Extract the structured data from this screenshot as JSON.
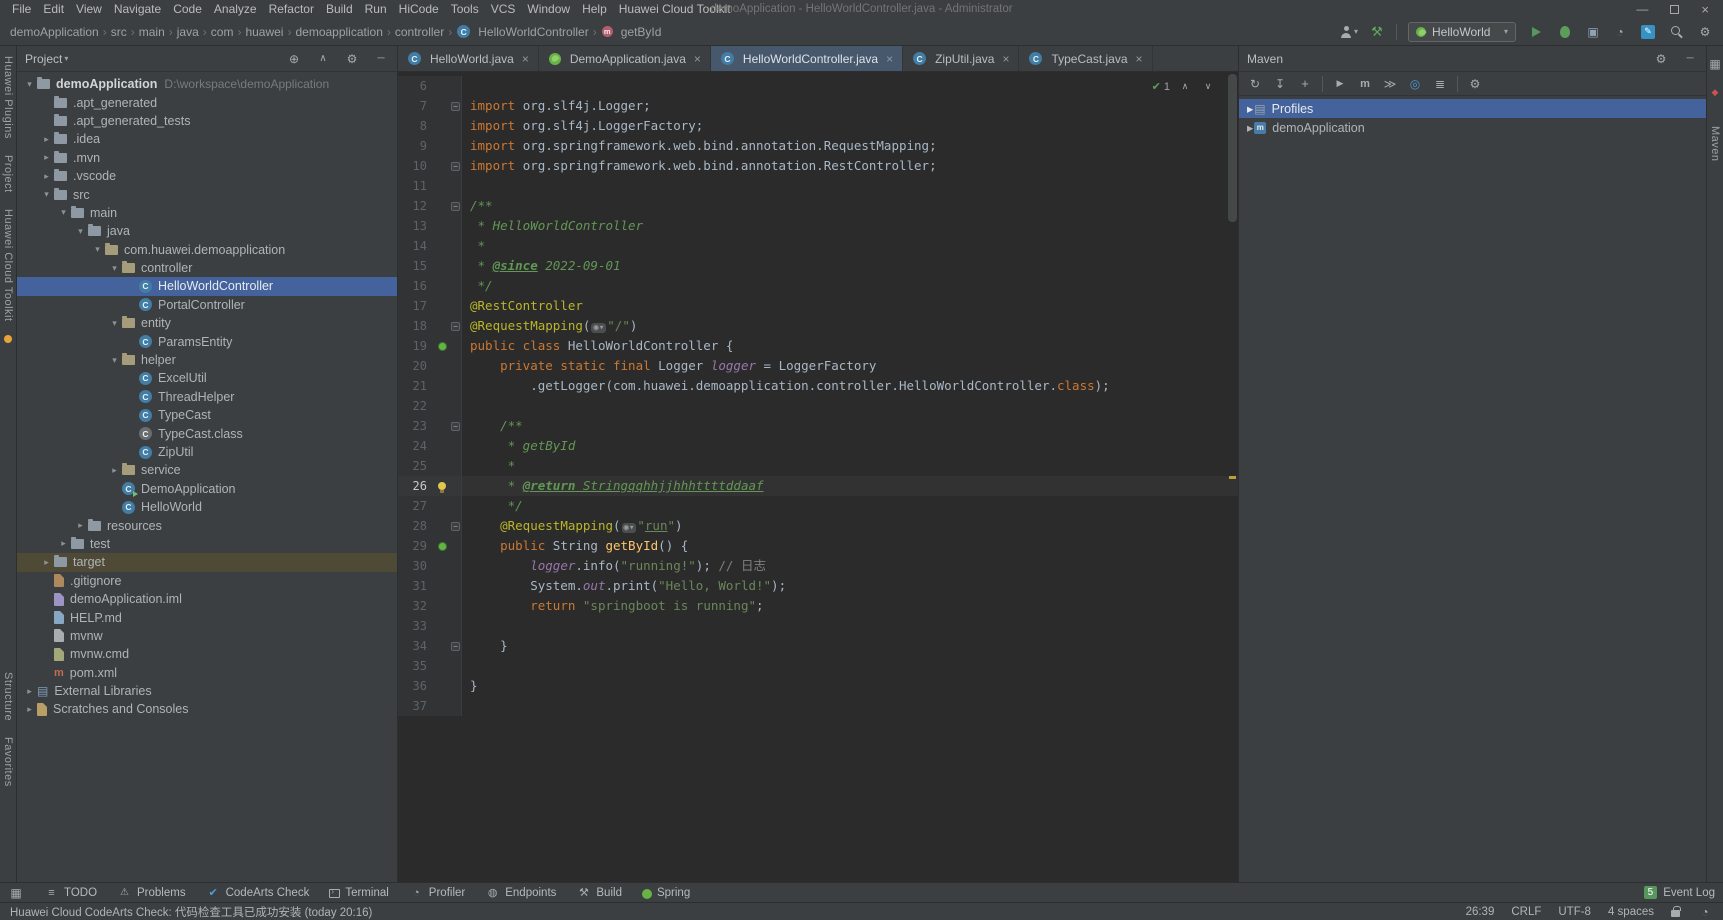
{
  "colors": {
    "panel_bg": "#3c3f41",
    "editor_bg": "#2b2b2b",
    "selection_blue": "#44639d",
    "target_highlight": "#4e4a35",
    "accent_green": "#57965c",
    "keyword_orange": "#cc7832",
    "string_green": "#6a8759",
    "annotation_yellow": "#bbb529"
  },
  "title_bar": {
    "menus": [
      "File",
      "Edit",
      "View",
      "Navigate",
      "Code",
      "Analyze",
      "Refactor",
      "Build",
      "Run",
      "HiCode",
      "Tools",
      "VCS",
      "Window",
      "Help",
      "Huawei Cloud Toolkit"
    ],
    "title": "demoApplication - HelloWorldController.java - Administrator"
  },
  "nav_bar": {
    "breadcrumbs": [
      {
        "label": "demoApplication"
      },
      {
        "label": "src"
      },
      {
        "label": "main"
      },
      {
        "label": "java"
      },
      {
        "label": "com"
      },
      {
        "label": "huawei"
      },
      {
        "label": "demoapplication"
      },
      {
        "label": "controller"
      },
      {
        "label": "HelloWorldController",
        "icon": "cls"
      },
      {
        "label": "getById",
        "icon": "mth"
      }
    ],
    "run_config": "HelloWorld"
  },
  "left_stripe": {
    "top": [
      "Huawei Plugins",
      "Project",
      "Huawei Cloud Toolkit"
    ],
    "bottom": [
      "Structure",
      "Favorites"
    ]
  },
  "right_stripe": {
    "labels": [
      "Maven"
    ]
  },
  "project": {
    "header_title": "Project",
    "tree": [
      {
        "label": "demoApplication",
        "path": "D:\\workspace\\demoApplication",
        "depth": 0,
        "arrow": "down",
        "icon": "folder",
        "root": true
      },
      {
        "label": ".apt_generated",
        "depth": 1,
        "arrow": "none",
        "icon": "folder"
      },
      {
        "label": ".apt_generated_tests",
        "depth": 1,
        "arrow": "none",
        "icon": "folder"
      },
      {
        "label": ".idea",
        "depth": 1,
        "arrow": "right",
        "icon": "folder"
      },
      {
        "label": ".mvn",
        "depth": 1,
        "arrow": "right",
        "icon": "folder"
      },
      {
        "label": ".vscode",
        "depth": 1,
        "arrow": "right",
        "icon": "folder"
      },
      {
        "label": "src",
        "depth": 1,
        "arrow": "down",
        "icon": "folder"
      },
      {
        "label": "main",
        "depth": 2,
        "arrow": "down",
        "icon": "folder"
      },
      {
        "label": "java",
        "depth": 3,
        "arrow": "down",
        "icon": "folder"
      },
      {
        "label": "com.huawei.demoapplication",
        "depth": 4,
        "arrow": "down",
        "icon": "pkg"
      },
      {
        "label": "controller",
        "depth": 5,
        "arrow": "down",
        "icon": "pkg"
      },
      {
        "label": "HelloWorldController",
        "depth": 6,
        "arrow": "none",
        "icon": "cls",
        "selected": true
      },
      {
        "label": "PortalController",
        "depth": 6,
        "arrow": "none",
        "icon": "cls"
      },
      {
        "label": "entity",
        "depth": 5,
        "arrow": "down",
        "icon": "pkg"
      },
      {
        "label": "ParamsEntity",
        "depth": 6,
        "arrow": "none",
        "icon": "cls"
      },
      {
        "label": "helper",
        "depth": 5,
        "arrow": "down",
        "icon": "pkg"
      },
      {
        "label": "ExcelUtil",
        "depth": 6,
        "arrow": "none",
        "icon": "cls"
      },
      {
        "label": "ThreadHelper",
        "depth": 6,
        "arrow": "none",
        "icon": "cls"
      },
      {
        "label": "TypeCast",
        "depth": 6,
        "arrow": "none",
        "icon": "cls"
      },
      {
        "label": "TypeCast.class",
        "depth": 6,
        "arrow": "none",
        "icon": "clsfile"
      },
      {
        "label": "ZipUtil",
        "depth": 6,
        "arrow": "none",
        "icon": "cls"
      },
      {
        "label": "service",
        "depth": 5,
        "arrow": "right",
        "icon": "pkg"
      },
      {
        "label": "DemoApplication",
        "depth": 5,
        "arrow": "none",
        "icon": "clsrun"
      },
      {
        "label": "HelloWorld",
        "depth": 5,
        "arrow": "none",
        "icon": "cls"
      },
      {
        "label": "resources",
        "depth": 3,
        "arrow": "right",
        "icon": "folder"
      },
      {
        "label": "test",
        "depth": 2,
        "arrow": "right",
        "icon": "folder"
      },
      {
        "label": "target",
        "depth": 1,
        "arrow": "right",
        "icon": "folder",
        "highlight": true
      },
      {
        "label": ".gitignore",
        "depth": 1,
        "arrow": "none",
        "icon": "git"
      },
      {
        "label": "demoApplication.iml",
        "depth": 1,
        "arrow": "none",
        "icon": "iml"
      },
      {
        "label": "HELP.md",
        "depth": 1,
        "arrow": "none",
        "icon": "md"
      },
      {
        "label": "mvnw",
        "depth": 1,
        "arrow": "none",
        "icon": "file"
      },
      {
        "label": "mvnw.cmd",
        "depth": 1,
        "arrow": "none",
        "icon": "cmd"
      },
      {
        "label": "pom.xml",
        "depth": 1,
        "arrow": "none",
        "icon": "maven"
      },
      {
        "label": "External Libraries",
        "depth": 0,
        "arrow": "right",
        "icon": "lib"
      },
      {
        "label": "Scratches and Consoles",
        "depth": 0,
        "arrow": "right",
        "icon": "scratch"
      }
    ]
  },
  "editor": {
    "tabs": [
      {
        "label": "HelloWorld.java",
        "icon": "cls"
      },
      {
        "label": "DemoApplication.java",
        "icon": "spring"
      },
      {
        "label": "HelloWorldController.java",
        "icon": "cls",
        "active": true
      },
      {
        "label": "ZipUtil.java",
        "icon": "cls"
      },
      {
        "label": "TypeCast.java",
        "icon": "cls"
      }
    ],
    "inspection_count": "1",
    "lines": [
      {
        "n": 6,
        "segs": []
      },
      {
        "n": 7,
        "fold": true,
        "segs": [
          {
            "c": "kw",
            "t": "import "
          },
          {
            "c": "p",
            "t": "org.slf4j.Logger;"
          }
        ]
      },
      {
        "n": 8,
        "segs": [
          {
            "c": "kw",
            "t": "import "
          },
          {
            "c": "p",
            "t": "org.slf4j.LoggerFactory;"
          }
        ]
      },
      {
        "n": 9,
        "segs": [
          {
            "c": "kw",
            "t": "import "
          },
          {
            "c": "p",
            "t": "org.springframework.web.bind.annotation.RequestMapping;"
          }
        ]
      },
      {
        "n": 10,
        "fold": true,
        "segs": [
          {
            "c": "kw",
            "t": "import "
          },
          {
            "c": "p",
            "t": "org.springframework.web.bind.annotation.RestController;"
          }
        ]
      },
      {
        "n": 11,
        "segs": []
      },
      {
        "n": 12,
        "fold": true,
        "segs": [
          {
            "c": "doc",
            "t": "/**"
          }
        ]
      },
      {
        "n": 13,
        "segs": [
          {
            "c": "doc",
            "t": " * HelloWorldController"
          }
        ]
      },
      {
        "n": 14,
        "segs": [
          {
            "c": "doc",
            "t": " *"
          }
        ]
      },
      {
        "n": 15,
        "segs": [
          {
            "c": "doc",
            "t": " * "
          },
          {
            "c": "dtag",
            "t": "@since"
          },
          {
            "c": "doc",
            "t": " 2022-09-01"
          }
        ]
      },
      {
        "n": 16,
        "segs": [
          {
            "c": "doc",
            "t": " */"
          }
        ]
      },
      {
        "n": 17,
        "segs": [
          {
            "c": "ann",
            "t": "@RestController"
          }
        ]
      },
      {
        "n": 18,
        "fold": true,
        "segs": [
          {
            "c": "ann",
            "t": "@RequestMapping"
          },
          {
            "c": "p",
            "t": "("
          },
          {
            "c": "inlay",
            "t": "◉▾"
          },
          {
            "c": "str",
            "t": "\"/\""
          },
          {
            "c": "p",
            "t": ")"
          }
        ]
      },
      {
        "n": 19,
        "bean": true,
        "segs": [
          {
            "c": "kw",
            "t": "public class "
          },
          {
            "c": "p",
            "t": "HelloWorldController {"
          }
        ]
      },
      {
        "n": 20,
        "segs": [
          {
            "c": "p",
            "t": "    "
          },
          {
            "c": "kw",
            "t": "private static final "
          },
          {
            "c": "p",
            "t": "Logger "
          },
          {
            "c": "fld",
            "t": "logger"
          },
          {
            "c": "p",
            "t": " = LoggerFactory"
          }
        ]
      },
      {
        "n": 21,
        "segs": [
          {
            "c": "p",
            "t": "        .getLogger(com.huawei.demoapplication.controller.HelloWorldController."
          },
          {
            "c": "kw",
            "t": "class"
          },
          {
            "c": "p",
            "t": ");"
          }
        ]
      },
      {
        "n": 22,
        "segs": []
      },
      {
        "n": 23,
        "fold": true,
        "segs": [
          {
            "c": "p",
            "t": "    "
          },
          {
            "c": "doc",
            "t": "/**"
          }
        ]
      },
      {
        "n": 24,
        "segs": [
          {
            "c": "doc",
            "t": "     * getById"
          }
        ]
      },
      {
        "n": 25,
        "segs": [
          {
            "c": "doc",
            "t": "     *"
          }
        ]
      },
      {
        "n": 26,
        "caret": true,
        "bulb": true,
        "segs": [
          {
            "c": "doc",
            "t": "     * "
          },
          {
            "c": "dtag",
            "t": "@return"
          },
          {
            "c": "dtxt",
            "t": " Stringqqhhjjhhhttttddaaf"
          }
        ]
      },
      {
        "n": 27,
        "segs": [
          {
            "c": "doc",
            "t": "     */"
          }
        ]
      },
      {
        "n": 28,
        "fold": true,
        "segs": [
          {
            "c": "p",
            "t": "    "
          },
          {
            "c": "ann",
            "t": "@RequestMapping"
          },
          {
            "c": "p",
            "t": "("
          },
          {
            "c": "inlay",
            "t": "◉▾"
          },
          {
            "c": "str",
            "t": "\""
          },
          {
            "c": "stru",
            "t": "run"
          },
          {
            "c": "str",
            "t": "\""
          },
          {
            "c": "p",
            "t": ")"
          }
        ]
      },
      {
        "n": 29,
        "bean": true,
        "segs": [
          {
            "c": "p",
            "t": "    "
          },
          {
            "c": "kw",
            "t": "public "
          },
          {
            "c": "p",
            "t": "String "
          },
          {
            "c": "mth",
            "t": "getById"
          },
          {
            "c": "p",
            "t": "() {"
          }
        ]
      },
      {
        "n": 30,
        "segs": [
          {
            "c": "p",
            "t": "        "
          },
          {
            "c": "fld",
            "t": "logger"
          },
          {
            "c": "p",
            "t": ".info("
          },
          {
            "c": "str",
            "t": "\"running!\""
          },
          {
            "c": "p",
            "t": "); "
          },
          {
            "c": "lcom",
            "t": "// 日志"
          }
        ]
      },
      {
        "n": 31,
        "segs": [
          {
            "c": "p",
            "t": "        System."
          },
          {
            "c": "fld",
            "t": "out"
          },
          {
            "c": "p",
            "t": ".print("
          },
          {
            "c": "str",
            "t": "\"Hello, World!\""
          },
          {
            "c": "p",
            "t": ");"
          }
        ]
      },
      {
        "n": 32,
        "segs": [
          {
            "c": "p",
            "t": "        "
          },
          {
            "c": "kw",
            "t": "return "
          },
          {
            "c": "str",
            "t": "\"springboot is running\""
          },
          {
            "c": "p",
            "t": ";"
          }
        ]
      },
      {
        "n": 33,
        "segs": []
      },
      {
        "n": 34,
        "fold": true,
        "segs": [
          {
            "c": "p",
            "t": "    }"
          }
        ]
      },
      {
        "n": 35,
        "segs": []
      },
      {
        "n": 36,
        "segs": [
          {
            "c": "p",
            "t": "}"
          }
        ]
      },
      {
        "n": 37,
        "segs": []
      }
    ]
  },
  "maven": {
    "title": "Maven",
    "nodes": [
      {
        "label": "Profiles",
        "icon": "profiles",
        "arrow": "right",
        "selected": true
      },
      {
        "label": "demoApplication",
        "icon": "mvnprj",
        "arrow": "right"
      }
    ]
  },
  "bottom_bar": {
    "items": [
      {
        "label": "TODO",
        "icon": "todo"
      },
      {
        "label": "Problems",
        "icon": "problems"
      },
      {
        "label": "CodeArts Check",
        "icon": "check"
      },
      {
        "label": "Terminal",
        "icon": "terminal"
      },
      {
        "label": "Profiler",
        "icon": "profiler"
      },
      {
        "label": "Endpoints",
        "icon": "endpoints"
      },
      {
        "label": "Build",
        "icon": "build"
      },
      {
        "label": "Spring",
        "icon": "spring"
      }
    ],
    "event_count": "5",
    "event_log_label": "Event Log"
  },
  "status_bar": {
    "message": "Huawei Cloud CodeArts Check: 代码检查工具已成功安装 (today 20:16)",
    "position": "26:39",
    "line_sep": "CRLF",
    "encoding": "UTF-8",
    "indent": "4 spaces"
  }
}
